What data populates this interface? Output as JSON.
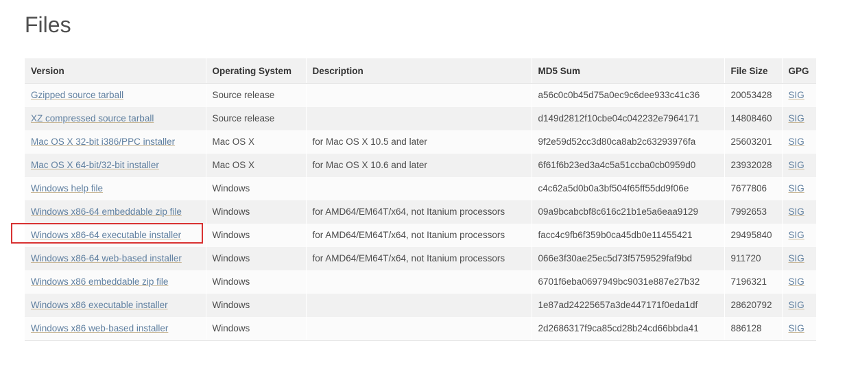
{
  "page": {
    "title": "Files",
    "background": "#ffffff",
    "accent_link_color": "#5f7f9f",
    "annotation_color": "#d83232"
  },
  "table": {
    "columns": [
      {
        "key": "version",
        "label": "Version"
      },
      {
        "key": "os",
        "label": "Operating System"
      },
      {
        "key": "description",
        "label": "Description"
      },
      {
        "key": "md5",
        "label": "MD5 Sum"
      },
      {
        "key": "size",
        "label": "File Size"
      },
      {
        "key": "gpg",
        "label": "GPG"
      }
    ],
    "rows": [
      {
        "version": "Gzipped source tarball",
        "os": "Source release",
        "description": "",
        "md5": "a56c0c0b45d75a0ec9c6dee933c41c36",
        "size": "20053428",
        "gpg": "SIG",
        "highlighted": false
      },
      {
        "version": "XZ compressed source tarball",
        "os": "Source release",
        "description": "",
        "md5": "d149d2812f10cbe04c042232e7964171",
        "size": "14808460",
        "gpg": "SIG",
        "highlighted": false
      },
      {
        "version": "Mac OS X 32-bit i386/PPC installer",
        "os": "Mac OS X",
        "description": "for Mac OS X 10.5 and later",
        "md5": "9f2e59d52cc3d80ca8ab2c63293976fa",
        "size": "25603201",
        "gpg": "SIG",
        "highlighted": false
      },
      {
        "version": "Mac OS X 64-bit/32-bit installer",
        "os": "Mac OS X",
        "description": "for Mac OS X 10.6 and later",
        "md5": "6f61f6b23ed3a4c5a51ccba0cb0959d0",
        "size": "23932028",
        "gpg": "SIG",
        "highlighted": false
      },
      {
        "version": "Windows help file",
        "os": "Windows",
        "description": "",
        "md5": "c4c62a5d0b0a3bf504f65ff55dd9f06e",
        "size": "7677806",
        "gpg": "SIG",
        "highlighted": false
      },
      {
        "version": "Windows x86-64 embeddable zip file",
        "os": "Windows",
        "description": "for AMD64/EM64T/x64, not Itanium processors",
        "md5": "09a9bcabcbf8c616c21b1e5a6eaa9129",
        "size": "7992653",
        "gpg": "SIG",
        "highlighted": false
      },
      {
        "version": "Windows x86-64 executable installer",
        "os": "Windows",
        "description": "for AMD64/EM64T/x64, not Itanium processors",
        "md5": "facc4c9fb6f359b0ca45db0e11455421",
        "size": "29495840",
        "gpg": "SIG",
        "highlighted": true
      },
      {
        "version": "Windows x86-64 web-based installer",
        "os": "Windows",
        "description": "for AMD64/EM64T/x64, not Itanium processors",
        "md5": "066e3f30ae25ec5d73f5759529faf9bd",
        "size": "911720",
        "gpg": "SIG",
        "highlighted": false
      },
      {
        "version": "Windows x86 embeddable zip file",
        "os": "Windows",
        "description": "",
        "md5": "6701f6eba0697949bc9031e887e27b32",
        "size": "7196321",
        "gpg": "SIG",
        "highlighted": false
      },
      {
        "version": "Windows x86 executable installer",
        "os": "Windows",
        "description": "",
        "md5": "1e87ad24225657a3de447171f0eda1df",
        "size": "28620792",
        "gpg": "SIG",
        "highlighted": false
      },
      {
        "version": "Windows x86 web-based installer",
        "os": "Windows",
        "description": "",
        "md5": "2d2686317f9ca85cd28b24cd66bbda41",
        "size": "886128",
        "gpg": "SIG",
        "highlighted": false
      }
    ]
  }
}
